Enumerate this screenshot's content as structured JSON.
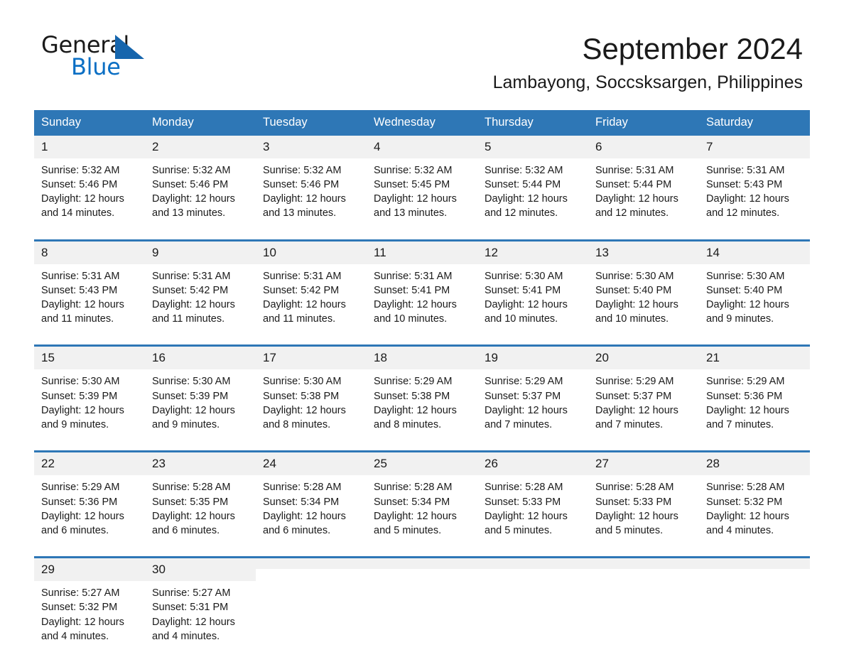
{
  "brand": {
    "name_part1": "General",
    "name_part2": "Blue",
    "triangle_color": "#1565ad",
    "blue_color": "#0b6fc4"
  },
  "header": {
    "month_title": "September 2024",
    "location": "Lambayong, Soccsksargen, Philippines"
  },
  "calendar": {
    "header_bg": "#2e77b6",
    "daynum_bg": "#f1f1f1",
    "separator_color": "#2e77b6",
    "weekday_headers": [
      "Sunday",
      "Monday",
      "Tuesday",
      "Wednesday",
      "Thursday",
      "Friday",
      "Saturday"
    ],
    "weeks": [
      [
        {
          "day": "1",
          "sunrise": "Sunrise: 5:32 AM",
          "sunset": "Sunset: 5:46 PM",
          "daylight_line1": "Daylight: 12 hours",
          "daylight_line2": "and 14 minutes."
        },
        {
          "day": "2",
          "sunrise": "Sunrise: 5:32 AM",
          "sunset": "Sunset: 5:46 PM",
          "daylight_line1": "Daylight: 12 hours",
          "daylight_line2": "and 13 minutes."
        },
        {
          "day": "3",
          "sunrise": "Sunrise: 5:32 AM",
          "sunset": "Sunset: 5:46 PM",
          "daylight_line1": "Daylight: 12 hours",
          "daylight_line2": "and 13 minutes."
        },
        {
          "day": "4",
          "sunrise": "Sunrise: 5:32 AM",
          "sunset": "Sunset: 5:45 PM",
          "daylight_line1": "Daylight: 12 hours",
          "daylight_line2": "and 13 minutes."
        },
        {
          "day": "5",
          "sunrise": "Sunrise: 5:32 AM",
          "sunset": "Sunset: 5:44 PM",
          "daylight_line1": "Daylight: 12 hours",
          "daylight_line2": "and 12 minutes."
        },
        {
          "day": "6",
          "sunrise": "Sunrise: 5:31 AM",
          "sunset": "Sunset: 5:44 PM",
          "daylight_line1": "Daylight: 12 hours",
          "daylight_line2": "and 12 minutes."
        },
        {
          "day": "7",
          "sunrise": "Sunrise: 5:31 AM",
          "sunset": "Sunset: 5:43 PM",
          "daylight_line1": "Daylight: 12 hours",
          "daylight_line2": "and 12 minutes."
        }
      ],
      [
        {
          "day": "8",
          "sunrise": "Sunrise: 5:31 AM",
          "sunset": "Sunset: 5:43 PM",
          "daylight_line1": "Daylight: 12 hours",
          "daylight_line2": "and 11 minutes."
        },
        {
          "day": "9",
          "sunrise": "Sunrise: 5:31 AM",
          "sunset": "Sunset: 5:42 PM",
          "daylight_line1": "Daylight: 12 hours",
          "daylight_line2": "and 11 minutes."
        },
        {
          "day": "10",
          "sunrise": "Sunrise: 5:31 AM",
          "sunset": "Sunset: 5:42 PM",
          "daylight_line1": "Daylight: 12 hours",
          "daylight_line2": "and 11 minutes."
        },
        {
          "day": "11",
          "sunrise": "Sunrise: 5:31 AM",
          "sunset": "Sunset: 5:41 PM",
          "daylight_line1": "Daylight: 12 hours",
          "daylight_line2": "and 10 minutes."
        },
        {
          "day": "12",
          "sunrise": "Sunrise: 5:30 AM",
          "sunset": "Sunset: 5:41 PM",
          "daylight_line1": "Daylight: 12 hours",
          "daylight_line2": "and 10 minutes."
        },
        {
          "day": "13",
          "sunrise": "Sunrise: 5:30 AM",
          "sunset": "Sunset: 5:40 PM",
          "daylight_line1": "Daylight: 12 hours",
          "daylight_line2": "and 10 minutes."
        },
        {
          "day": "14",
          "sunrise": "Sunrise: 5:30 AM",
          "sunset": "Sunset: 5:40 PM",
          "daylight_line1": "Daylight: 12 hours",
          "daylight_line2": "and 9 minutes."
        }
      ],
      [
        {
          "day": "15",
          "sunrise": "Sunrise: 5:30 AM",
          "sunset": "Sunset: 5:39 PM",
          "daylight_line1": "Daylight: 12 hours",
          "daylight_line2": "and 9 minutes."
        },
        {
          "day": "16",
          "sunrise": "Sunrise: 5:30 AM",
          "sunset": "Sunset: 5:39 PM",
          "daylight_line1": "Daylight: 12 hours",
          "daylight_line2": "and 9 minutes."
        },
        {
          "day": "17",
          "sunrise": "Sunrise: 5:30 AM",
          "sunset": "Sunset: 5:38 PM",
          "daylight_line1": "Daylight: 12 hours",
          "daylight_line2": "and 8 minutes."
        },
        {
          "day": "18",
          "sunrise": "Sunrise: 5:29 AM",
          "sunset": "Sunset: 5:38 PM",
          "daylight_line1": "Daylight: 12 hours",
          "daylight_line2": "and 8 minutes."
        },
        {
          "day": "19",
          "sunrise": "Sunrise: 5:29 AM",
          "sunset": "Sunset: 5:37 PM",
          "daylight_line1": "Daylight: 12 hours",
          "daylight_line2": "and 7 minutes."
        },
        {
          "day": "20",
          "sunrise": "Sunrise: 5:29 AM",
          "sunset": "Sunset: 5:37 PM",
          "daylight_line1": "Daylight: 12 hours",
          "daylight_line2": "and 7 minutes."
        },
        {
          "day": "21",
          "sunrise": "Sunrise: 5:29 AM",
          "sunset": "Sunset: 5:36 PM",
          "daylight_line1": "Daylight: 12 hours",
          "daylight_line2": "and 7 minutes."
        }
      ],
      [
        {
          "day": "22",
          "sunrise": "Sunrise: 5:29 AM",
          "sunset": "Sunset: 5:36 PM",
          "daylight_line1": "Daylight: 12 hours",
          "daylight_line2": "and 6 minutes."
        },
        {
          "day": "23",
          "sunrise": "Sunrise: 5:28 AM",
          "sunset": "Sunset: 5:35 PM",
          "daylight_line1": "Daylight: 12 hours",
          "daylight_line2": "and 6 minutes."
        },
        {
          "day": "24",
          "sunrise": "Sunrise: 5:28 AM",
          "sunset": "Sunset: 5:34 PM",
          "daylight_line1": "Daylight: 12 hours",
          "daylight_line2": "and 6 minutes."
        },
        {
          "day": "25",
          "sunrise": "Sunrise: 5:28 AM",
          "sunset": "Sunset: 5:34 PM",
          "daylight_line1": "Daylight: 12 hours",
          "daylight_line2": "and 5 minutes."
        },
        {
          "day": "26",
          "sunrise": "Sunrise: 5:28 AM",
          "sunset": "Sunset: 5:33 PM",
          "daylight_line1": "Daylight: 12 hours",
          "daylight_line2": "and 5 minutes."
        },
        {
          "day": "27",
          "sunrise": "Sunrise: 5:28 AM",
          "sunset": "Sunset: 5:33 PM",
          "daylight_line1": "Daylight: 12 hours",
          "daylight_line2": "and 5 minutes."
        },
        {
          "day": "28",
          "sunrise": "Sunrise: 5:28 AM",
          "sunset": "Sunset: 5:32 PM",
          "daylight_line1": "Daylight: 12 hours",
          "daylight_line2": "and 4 minutes."
        }
      ],
      [
        {
          "day": "29",
          "sunrise": "Sunrise: 5:27 AM",
          "sunset": "Sunset: 5:32 PM",
          "daylight_line1": "Daylight: 12 hours",
          "daylight_line2": "and 4 minutes."
        },
        {
          "day": "30",
          "sunrise": "Sunrise: 5:27 AM",
          "sunset": "Sunset: 5:31 PM",
          "daylight_line1": "Daylight: 12 hours",
          "daylight_line2": "and 4 minutes."
        },
        {
          "day": "",
          "sunrise": "",
          "sunset": "",
          "daylight_line1": "",
          "daylight_line2": ""
        },
        {
          "day": "",
          "sunrise": "",
          "sunset": "",
          "daylight_line1": "",
          "daylight_line2": ""
        },
        {
          "day": "",
          "sunrise": "",
          "sunset": "",
          "daylight_line1": "",
          "daylight_line2": ""
        },
        {
          "day": "",
          "sunrise": "",
          "sunset": "",
          "daylight_line1": "",
          "daylight_line2": ""
        },
        {
          "day": "",
          "sunrise": "",
          "sunset": "",
          "daylight_line1": "",
          "daylight_line2": ""
        }
      ]
    ]
  }
}
